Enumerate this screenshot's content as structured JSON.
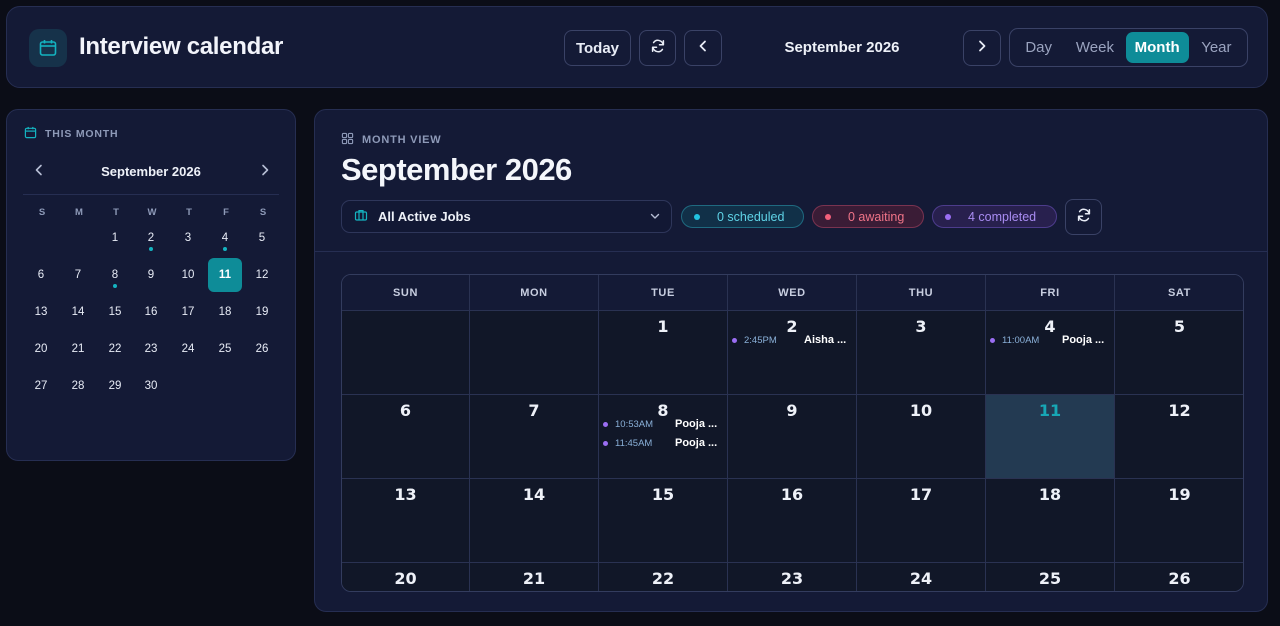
{
  "header": {
    "title": "Interview calendar",
    "today_label": "Today",
    "month_label": "September 2026",
    "views": [
      "Day",
      "Week",
      "Month",
      "Year"
    ],
    "active_view": "Month"
  },
  "sidebar": {
    "heading": "THIS MONTH",
    "month": "September 2026",
    "dow": [
      "S",
      "M",
      "T",
      "W",
      "T",
      "F",
      "S"
    ],
    "days": [
      "1",
      "2",
      "3",
      "4",
      "5",
      "6",
      "7",
      "8",
      "9",
      "10",
      "11",
      "12",
      "13",
      "14",
      "15",
      "16",
      "17",
      "18",
      "19",
      "20",
      "21",
      "22",
      "23",
      "24",
      "25",
      "26",
      "27",
      "28",
      "29",
      "30"
    ],
    "first_weekday": 2,
    "today": "11",
    "days_with_events": [
      "2",
      "4",
      "8"
    ]
  },
  "main": {
    "heading": "MONTH VIEW",
    "title": "September 2026",
    "job_filter": "All Active Jobs",
    "stats": {
      "scheduled": "0 scheduled",
      "awaiting": "0 awaiting",
      "completed": "4 completed"
    }
  },
  "calendar": {
    "dow": [
      "SUN",
      "MON",
      "TUE",
      "WED",
      "THU",
      "FRI",
      "SAT"
    ],
    "weeks": [
      [
        "",
        "",
        "1",
        "2",
        "3",
        "4",
        "5"
      ],
      [
        "6",
        "7",
        "8",
        "9",
        "10",
        "11",
        "12"
      ],
      [
        "13",
        "14",
        "15",
        "16",
        "17",
        "18",
        "19"
      ],
      [
        "20",
        "21",
        "22",
        "23",
        "24",
        "25",
        "26"
      ]
    ],
    "today": "11",
    "events": {
      "2": [
        {
          "time": "2:45PM",
          "name": "Aisha ..."
        }
      ],
      "4": [
        {
          "time": "11:00AM",
          "name": "Pooja ..."
        }
      ],
      "8": [
        {
          "time": "10:53AM",
          "name": "Pooja ..."
        },
        {
          "time": "11:45AM",
          "name": "Pooja ..."
        }
      ]
    }
  },
  "colors": {
    "accent": "#0e8c98",
    "scheduled": "#22c3e0",
    "awaiting": "#f3607a",
    "completed": "#9b6ef3"
  }
}
